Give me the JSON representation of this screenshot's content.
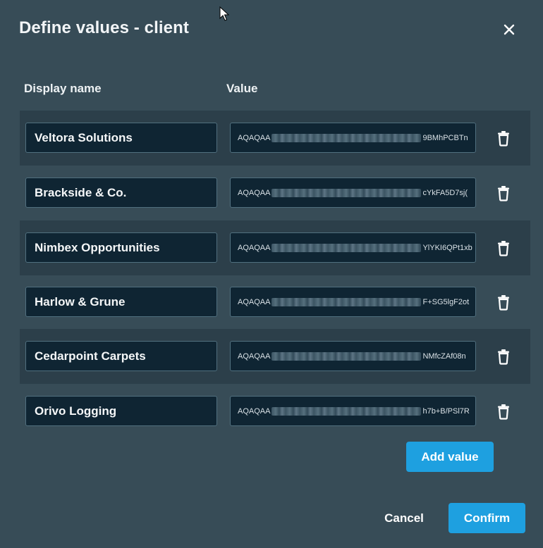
{
  "dialog": {
    "title": "Define values - client",
    "close_icon": "close-icon"
  },
  "columns": {
    "display_name": "Display name",
    "value": "Value"
  },
  "rows": [
    {
      "name": "Veltora Solutions",
      "value_prefix": "AQAQAA",
      "value_suffix": "9BMhPCBTn"
    },
    {
      "name": "Brackside & Co.",
      "value_prefix": "AQAQAA",
      "value_suffix": "cYkFA5D7sj("
    },
    {
      "name": "Nimbex Opportunities",
      "value_prefix": "AQAQAA",
      "value_suffix": "YlYKI6QPt1xb"
    },
    {
      "name": "Harlow & Grune",
      "value_prefix": "AQAQAA",
      "value_suffix": "F+SG5lgF2ot"
    },
    {
      "name": "Cedarpoint Carpets",
      "value_prefix": "AQAQAA",
      "value_suffix": "NMfcZAf08n"
    },
    {
      "name": "Orivo Logging",
      "value_prefix": "AQAQAA",
      "value_suffix": "h7b+B/PSl7R"
    }
  ],
  "actions": {
    "add_value": "Add value",
    "cancel": "Cancel",
    "confirm": "Confirm"
  },
  "colors": {
    "background": "#374c57",
    "row_shade": "#2c3f4a",
    "input_bg": "#0f2533",
    "accent": "#1ea0e0"
  }
}
